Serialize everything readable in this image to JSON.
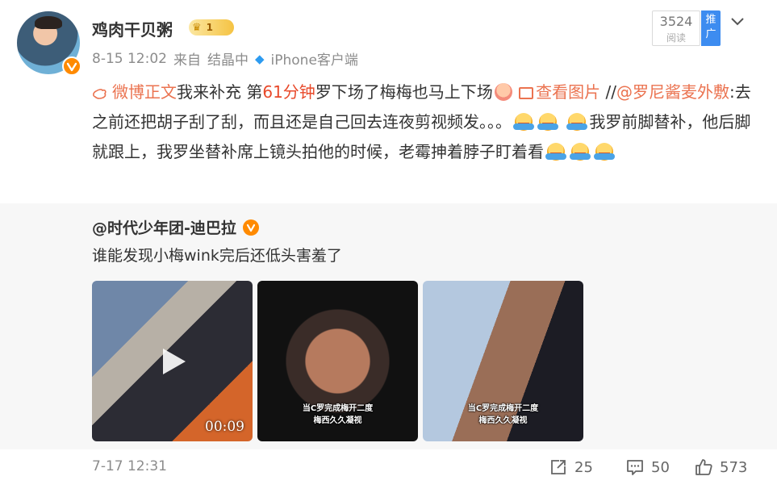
{
  "post": {
    "author_name": "鸡肉干贝粥",
    "vip_level": "1",
    "time": "8-15 12:02",
    "source_prefix": "来自",
    "source_topic": "结晶中",
    "source_device": "iPhone客户端",
    "read_count": "3524",
    "read_label": "阅读",
    "promo_label": "推广",
    "text": {
      "weibo_link": "微博正文",
      "part1": "我来补充 第",
      "highlight": "61分钟",
      "part2": "罗下场了梅梅也马上下场",
      "view_image": "查看图片",
      "sep": " //",
      "mention": "@罗尼酱麦外敷",
      "part3": ":去之前还把胡子刮了刮，而且还是自己回去连夜剪视频发。。。",
      "part4": "我罗前脚替补，他后脚就跟上，我罗坐替补席上镜头拍他的时候，老霉抻着脖子盯着看"
    }
  },
  "repost": {
    "author": "@时代少年团-迪巴拉",
    "text": "谁能发现小梅wink完后还低头害羞了",
    "thumbs": [
      {
        "name": "video-thumbnail",
        "duration": "00:09"
      },
      {
        "name": "image-thumbnail-2",
        "caption_line1": "当C罗完成梅开二度",
        "caption_line2": "梅西久久凝视"
      },
      {
        "name": "image-thumbnail-3",
        "caption_line1": "当C罗完成梅开二度",
        "caption_line2": "梅西久久凝视"
      }
    ],
    "date": "7-17 12:31",
    "reposts": "25",
    "comments": "50",
    "likes": "573"
  },
  "colors": {
    "link": "#eb7350",
    "highlight": "#e8492a",
    "accent_blue": "#3d8cf0",
    "verified": "#ff8a00"
  }
}
